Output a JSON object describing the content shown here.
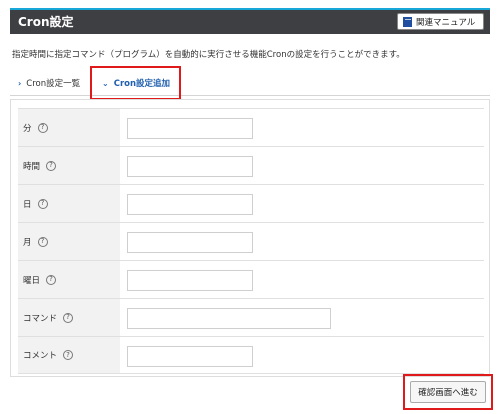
{
  "header": {
    "title": "Cron設定",
    "manual_label": "関連マニュアル"
  },
  "description": "指定時間に指定コマンド（プログラム）を自動的に実行させる機能Cronの設定を行うことができます。",
  "tabs": [
    {
      "label": "Cron設定一覧",
      "active": false
    },
    {
      "label": "Cron設定追加",
      "active": true
    }
  ],
  "form": {
    "rows": [
      {
        "label": "分",
        "help": "?",
        "value": "",
        "placeholder": ""
      },
      {
        "label": "時間",
        "help": "?",
        "value": "",
        "placeholder": ""
      },
      {
        "label": "日",
        "help": "?",
        "value": "",
        "placeholder": ""
      },
      {
        "label": "月",
        "help": "?",
        "value": "",
        "placeholder": ""
      },
      {
        "label": "曜日",
        "help": "?",
        "value": "",
        "placeholder": ""
      },
      {
        "label": "コマンド",
        "help": "?",
        "value": "",
        "placeholder": ""
      },
      {
        "label": "コメント",
        "help": "?",
        "value": "",
        "placeholder": ""
      }
    ]
  },
  "submit_label": "確認画面へ進む",
  "colors": {
    "header_bg": "#3d3f42",
    "header_accent": "#17a7d8",
    "highlight": "#e01a1a",
    "link": "#1f5fae"
  },
  "icons": {
    "manual": "book-icon",
    "tab": "chevron-icon",
    "help": "help-icon"
  }
}
